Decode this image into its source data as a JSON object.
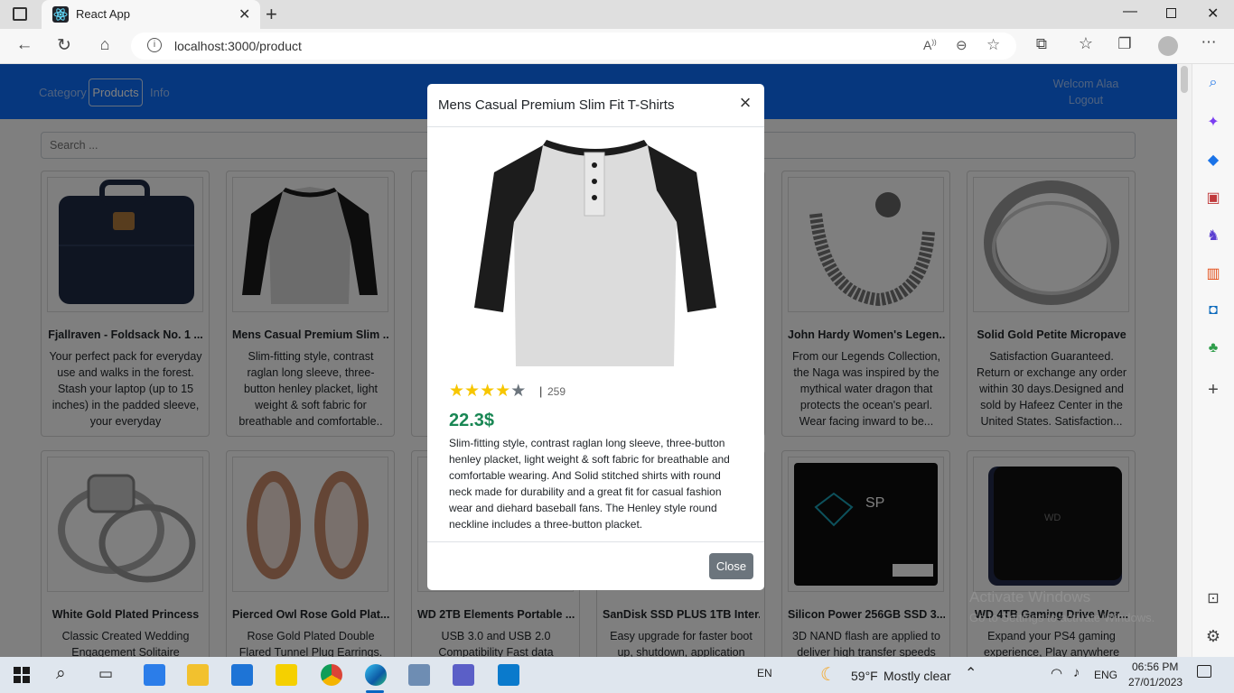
{
  "browser": {
    "tab_title": "React App",
    "url": "localhost:3000/product"
  },
  "navbar": {
    "links": [
      "Category",
      "Products",
      "Info"
    ],
    "active": "Products",
    "welcome": "Welcom Alaa",
    "logout": "Logout"
  },
  "search": {
    "placeholder": "Search ..."
  },
  "products": [
    {
      "title": "Fjallraven - Foldsack No. 1 ...",
      "desc": "Your perfect pack for everyday use and walks in the forest. Stash your laptop (up to 15 inches) in the padded sleeve, your everyday"
    },
    {
      "title": "Mens Casual Premium Slim ...",
      "desc": "Slim-fitting style, contrast raglan long sleeve, three-button henley placket, light weight & soft fabric for breathable and comfortable.."
    },
    {
      "title": "",
      "desc": ""
    },
    {
      "title": "",
      "desc": ""
    },
    {
      "title": "John Hardy Women's Legen...",
      "desc": "From our Legends Collection, the Naga was inspired by the mythical water dragon that protects the ocean's pearl. Wear facing inward to be..."
    },
    {
      "title": "Solid Gold Petite Micropave",
      "desc": "Satisfaction Guaranteed. Return or exchange any order within 30 days.Designed and sold by Hafeez Center in the United States. Satisfaction..."
    },
    {
      "title": "White Gold Plated Princess",
      "desc": "Classic Created Wedding Engagement Solitaire"
    },
    {
      "title": "Pierced Owl Rose Gold Plat...",
      "desc": "Rose Gold Plated Double Flared Tunnel Plug Earrings."
    },
    {
      "title": "WD 2TB Elements Portable ...",
      "desc": "USB 3.0 and USB 2.0 Compatibility Fast data"
    },
    {
      "title": "SanDisk SSD PLUS 1TB Inter...",
      "desc": "Easy upgrade for faster boot up, shutdown, application"
    },
    {
      "title": "Silicon Power 256GB SSD 3...",
      "desc": "3D NAND flash are applied to deliver high transfer speeds"
    },
    {
      "title": "WD 4TB Gaming Drive Wor...",
      "desc": "Expand your PS4 gaming experience, Play anywhere"
    }
  ],
  "modal": {
    "title": "Mens Casual Premium Slim Fit T-Shirts",
    "rating": 4,
    "rating_max": 5,
    "rating_separator": "|",
    "count": "259",
    "price": "22.3$",
    "description": "Slim-fitting style, contrast raglan long sleeve, three-button henley placket, light weight & soft fabric for breathable and comfortable wearing. And Solid stitched shirts with round neck made for durability and a great fit for casual fashion wear and diehard baseball fans. The Henley style round neckline includes a three-button placket.",
    "close_label": "Close"
  },
  "watermark": {
    "line1": "Activate Windows",
    "line2": "Go to Settings to activate Windows."
  },
  "taskbar": {
    "lang_left": "EN",
    "temperature": "59°F",
    "weather": "Mostly clear",
    "lang_right": "ENG",
    "time": "06:56 PM",
    "date": "27/01/2023"
  },
  "colors": {
    "navbar": "#0d6efd",
    "price": "#198754",
    "star": "#f7c600",
    "close_button": "#6c757d"
  }
}
